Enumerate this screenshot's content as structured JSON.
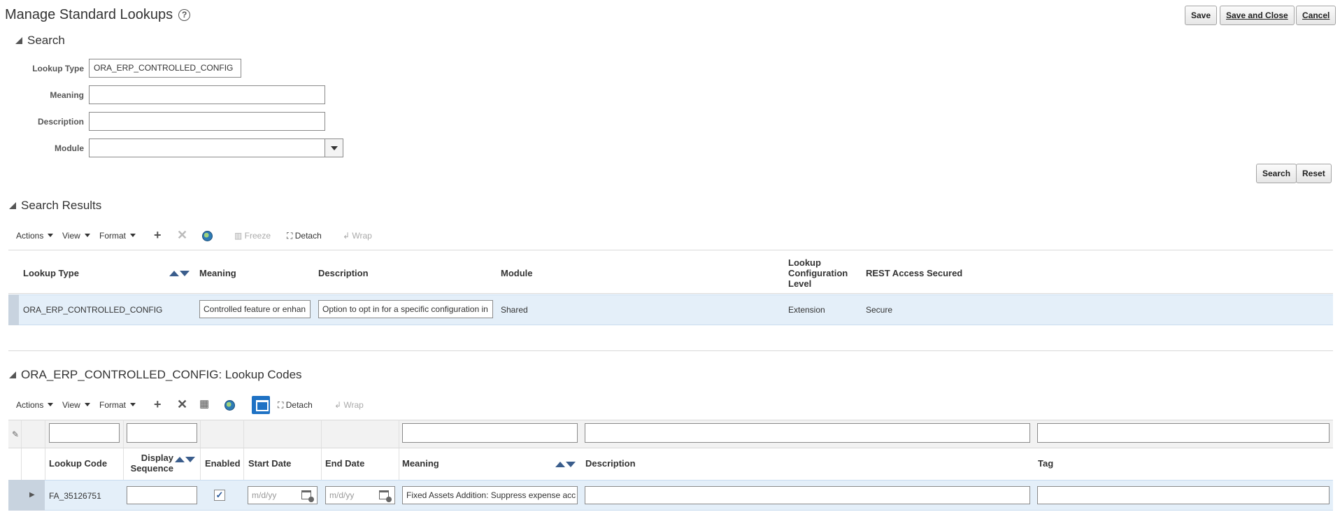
{
  "page": {
    "title": "Manage Standard Lookups",
    "help_icon": "?",
    "buttons": {
      "save": "Save",
      "save_close": "Save and Close",
      "cancel": "Cancel"
    }
  },
  "search": {
    "header": "Search",
    "fields": {
      "lookup_type_label": "Lookup Type",
      "lookup_type_value": "ORA_ERP_CONTROLLED_CONFIG",
      "meaning_label": "Meaning",
      "meaning_value": "",
      "description_label": "Description",
      "description_value": "",
      "module_label": "Module",
      "module_value": ""
    },
    "search_button": "Search",
    "reset_button": "Reset"
  },
  "results": {
    "header": "Search Results",
    "toolbar": {
      "actions": "Actions",
      "view": "View",
      "format": "Format",
      "freeze": "Freeze",
      "detach": "Detach",
      "wrap": "Wrap"
    },
    "columns": {
      "lookup_type": "Lookup Type",
      "meaning": "Meaning",
      "description": "Description",
      "module": "Module",
      "config_level_1": "Lookup",
      "config_level_2": "Configuration",
      "config_level_3": "Level",
      "rest": "REST Access Secured"
    },
    "row": {
      "lookup_type": "ORA_ERP_CONTROLLED_CONFIG",
      "meaning": "Controlled feature or enhan",
      "description": "Option to opt in for a specific configuration in",
      "module": "Shared",
      "config_level": "Extension",
      "rest": "Secure"
    }
  },
  "codes": {
    "header": "ORA_ERP_CONTROLLED_CONFIG: Lookup Codes",
    "toolbar": {
      "actions": "Actions",
      "view": "View",
      "format": "Format",
      "detach": "Detach",
      "wrap": "Wrap"
    },
    "columns": {
      "lookup_code": "Lookup Code",
      "display_seq_1": "Display",
      "display_seq_2": "Sequence",
      "enabled": "Enabled",
      "start_date": "Start Date",
      "end_date": "End Date",
      "meaning": "Meaning",
      "description": "Description",
      "tag": "Tag"
    },
    "row": {
      "lookup_code": "FA_35126751",
      "display_seq": "",
      "enabled": true,
      "start_date_placeholder": "m/d/yy",
      "end_date_placeholder": "m/d/yy",
      "meaning": "Fixed Assets Addition: Suppress expense acc",
      "description": "",
      "tag": ""
    }
  },
  "icons": {
    "help": "help-icon",
    "collapse": "collapse-triangle-icon",
    "add": "plus-icon",
    "delete": "x-icon",
    "query": "query-by-example-icon",
    "translate": "globe-icon",
    "calendar": "calendar-icon",
    "freeze": "freeze-icon",
    "detach": "detach-icon",
    "wrap": "wrap-icon"
  },
  "colors": {
    "selected_row": "#e4eff9",
    "accent": "#1f72c4",
    "sort_arrow": "#3a5d8c"
  }
}
